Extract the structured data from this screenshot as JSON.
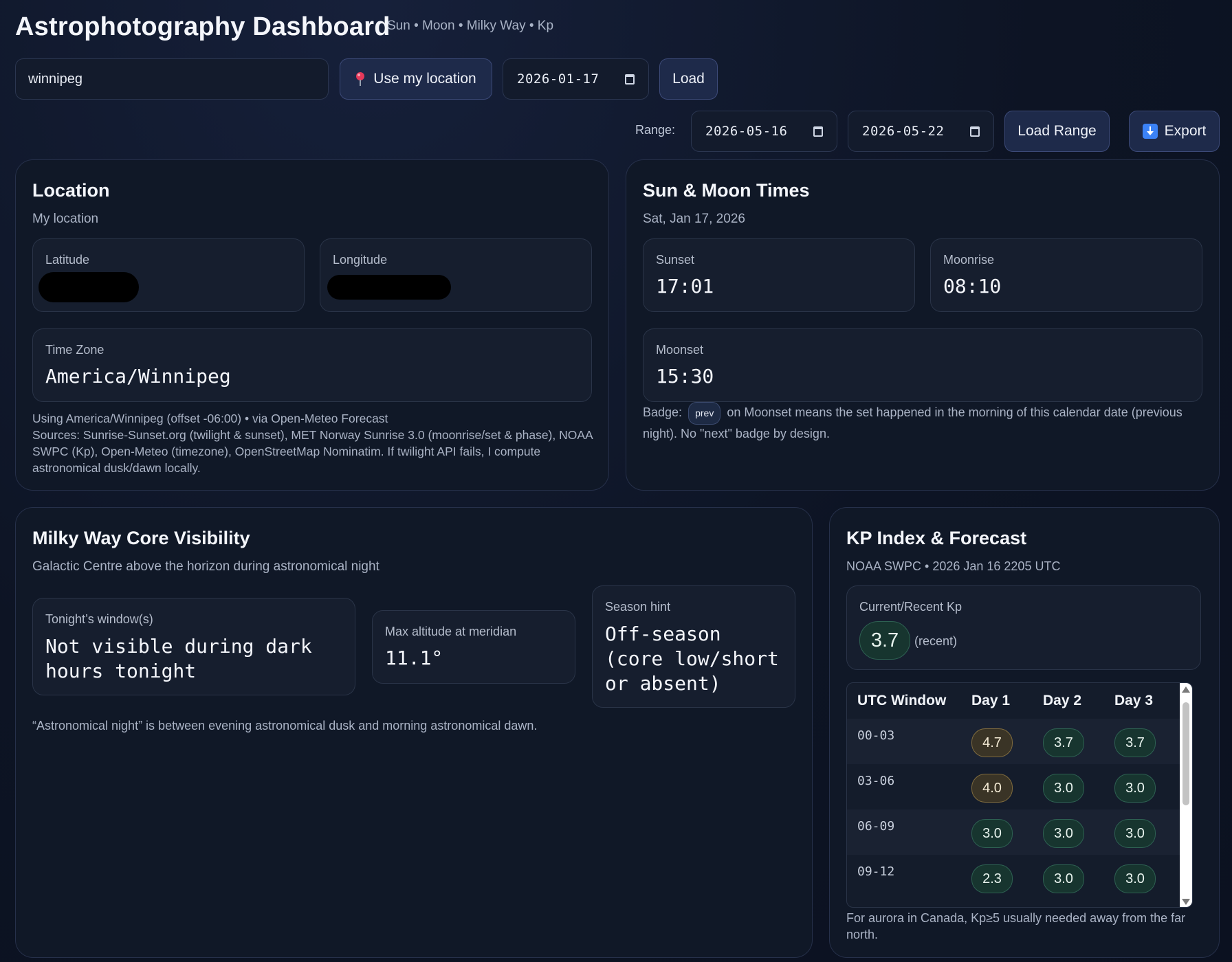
{
  "header": {
    "title": "Astrophotography Dashboard",
    "subtitle": "Sun • Moon • Milky Way • Kp"
  },
  "controls": {
    "search_value": "winnipeg",
    "use_location_label": "Use my location",
    "use_location_icon": "pin-icon",
    "date_value": "2026-01-17",
    "load_label": "Load",
    "range_label": "Range:",
    "range_start": "2026-05-16",
    "range_end": "2026-05-22",
    "load_range_label": "Load Range",
    "export_label": "Export",
    "export_icon": "download-icon"
  },
  "location": {
    "title": "Location",
    "subtitle": "My location",
    "latitude_label": "Latitude",
    "longitude_label": "Longitude",
    "timezone_label": "Time Zone",
    "timezone_value": "America/Winnipeg",
    "note_line1": "Using America/Winnipeg (offset -06:00) • via Open-Meteo Forecast",
    "note_line2": "Sources: Sunrise-Sunset.org (twilight & sunset), MET Norway Sunrise 3.0 (moonrise/set & phase), NOAA SWPC (Kp), Open-Meteo (timezone), OpenStreetMap Nominatim. If twilight API fails, I compute astronomical dusk/dawn locally."
  },
  "sunmoon": {
    "title": "Sun & Moon Times",
    "date": "Sat, Jan 17, 2026",
    "sunset_label": "Sunset",
    "sunset_value": "17:01",
    "moonrise_label": "Moonrise",
    "moonrise_value": "08:10",
    "moonset_label": "Moonset",
    "moonset_value": "15:30",
    "badge_prefix": "Badge:",
    "badge_text": "prev",
    "badge_note_line1": "on Moonset means the set happened in the morning of this calendar date (previous",
    "badge_note_line2": "night). No \"next\" badge by design."
  },
  "milkyway": {
    "title": "Milky Way Core Visibility",
    "subtitle": "Galactic Centre above the horizon during astronomical night",
    "window_label": "Tonight’s window(s)",
    "window_value_line1": "Not visible during dark",
    "window_value_line2": "hours tonight",
    "altitude_label": "Max altitude at meridian",
    "altitude_value": "11.1°",
    "season_label": "Season hint",
    "season_line1": "Off-season",
    "season_line2": "(core low/short",
    "season_line3": "or absent)",
    "note": "“Astronomical night” is between evening astronomical dusk and morning astronomical dawn."
  },
  "kp": {
    "title": "KP Index & Forecast",
    "source": "NOAA SWPC • 2026 Jan 16 2205 UTC",
    "current_label": "Current/Recent Kp",
    "current_value": "3.7",
    "current_suffix": "(recent)",
    "headers": [
      "UTC Window",
      "Day 1",
      "Day 2",
      "Day 3"
    ],
    "rows": [
      {
        "window": "00-03",
        "values": [
          "4.7",
          "3.7",
          "3.7"
        ],
        "levels": [
          "elevated",
          "normal",
          "normal"
        ]
      },
      {
        "window": "03-06",
        "values": [
          "4.0",
          "3.0",
          "3.0"
        ],
        "levels": [
          "elevated",
          "normal",
          "normal"
        ]
      },
      {
        "window": "06-09",
        "values": [
          "3.0",
          "3.0",
          "3.0"
        ],
        "levels": [
          "normal",
          "normal",
          "normal"
        ]
      },
      {
        "window": "09-12",
        "values": [
          "2.3",
          "3.0",
          "3.0"
        ],
        "levels": [
          "normal",
          "normal",
          "normal"
        ]
      }
    ],
    "footnote": "For aurora in Canada, Kp≥5 usually needed away from the far north."
  },
  "colors": {
    "background": "#0d1424",
    "panel": "#101827",
    "button": "#1e2a4a",
    "kp_normal": "#17352f",
    "kp_elevated": "#3a3426"
  }
}
